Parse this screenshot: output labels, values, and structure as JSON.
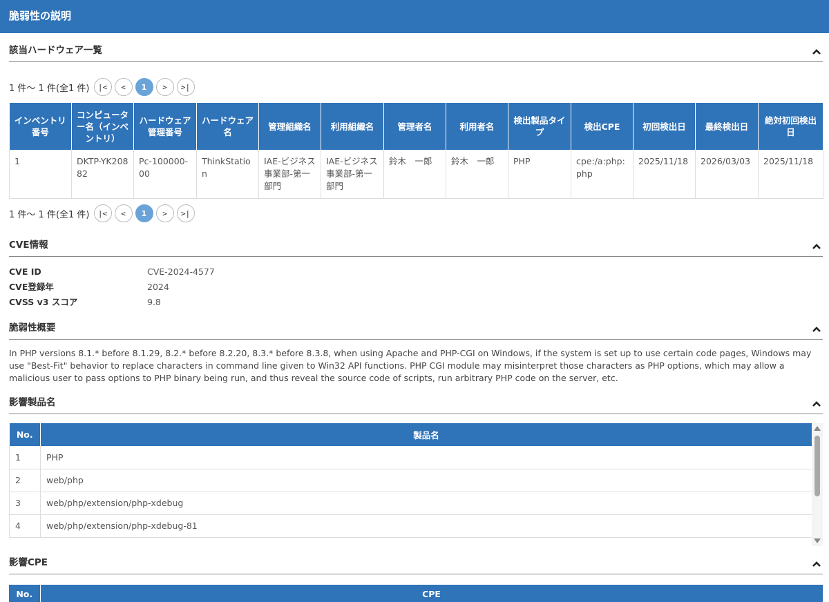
{
  "page_title": "脆弱性の説明",
  "sections": {
    "hardware": "該当ハードウェア一覧",
    "cve": "CVE情報",
    "summary": "脆弱性概要",
    "products": "影響製品名",
    "cpe": "影響CPE"
  },
  "pager": {
    "count_text": "1 件〜 1 件(全1 件)",
    "first": "|<",
    "prev": "<",
    "current": "1",
    "next": ">",
    "last": ">|"
  },
  "hardware_table": {
    "headers": [
      "インベントリ番号",
      "コンピューター名（インベントリ）",
      "ハードウェア管理番号",
      "ハードウェア名",
      "管理組織名",
      "利用組織名",
      "管理者名",
      "利用者名",
      "検出製品タイプ",
      "検出CPE",
      "初回検出日",
      "最終検出日",
      "絶対初回検出日"
    ],
    "rows": [
      [
        "1",
        "DKTP-YK20882",
        "Pc-100000-00",
        "ThinkStation",
        "IAE-ビジネス事業部-第一部門",
        "IAE-ビジネス事業部-第一部門",
        "鈴木　一郎",
        "鈴木　一郎",
        "PHP",
        "cpe:/a:php:php",
        "2025/11/18",
        "2026/03/03",
        "2025/11/18"
      ]
    ]
  },
  "cve_info": {
    "id_label": "CVE ID",
    "id_value": "CVE-2024-4577",
    "year_label": "CVE登録年",
    "year_value": "2024",
    "cvss_label": "CVSS v3 スコア",
    "cvss_value": "9.8"
  },
  "summary_text": "In PHP versions 8.1.* before 8.1.29, 8.2.* before 8.2.20, 8.3.* before 8.3.8, when using Apache and PHP-CGI on Windows, if the system is set up to use certain code pages, Windows may use \"Best-Fit\" behavior to replace characters in command line given to Win32 API functions. PHP CGI module may misinterpret those characters as PHP options, which may allow a malicious user to pass options to PHP binary being run, and thus reveal the source code of scripts, run arbitrary PHP code on the server, etc.",
  "products_table": {
    "headers": [
      "No.",
      "製品名"
    ],
    "rows": [
      [
        "1",
        "PHP"
      ],
      [
        "2",
        "web/php"
      ],
      [
        "3",
        "web/php/extension/php-xdebug"
      ],
      [
        "4",
        "web/php/extension/php-xdebug-81"
      ]
    ]
  },
  "cpe_table": {
    "headers": [
      "No.",
      "CPE"
    ]
  }
}
